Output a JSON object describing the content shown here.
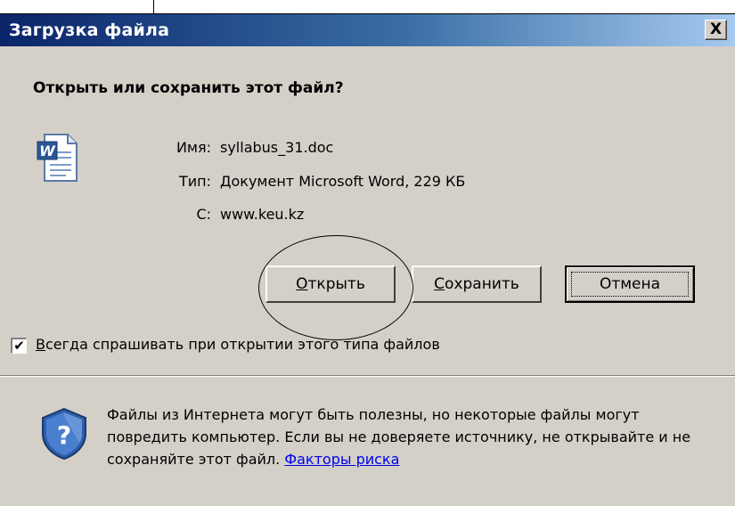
{
  "dialog": {
    "title": "Загрузка файла",
    "close_glyph": "X",
    "question": "Открыть или сохранить этот файл?",
    "file_icon": "word-document-icon",
    "file": {
      "name_label": "Имя:",
      "name_value": "syllabus_31.doc",
      "type_label": "Тип:",
      "type_value": "Документ Microsoft Word, 229 КБ",
      "from_label": "С:",
      "from_value": "www.keu.kz"
    },
    "buttons": {
      "open_accel": "О",
      "open_rest": "ткрыть",
      "save_accel": "С",
      "save_rest": "охранить",
      "cancel": "Отмена"
    },
    "checkbox": {
      "checked": true,
      "mark": "✔",
      "label_accel": "В",
      "label_rest": "сегда спрашивать при открытии этого типа файлов"
    },
    "warning": {
      "icon": "shield-question-icon",
      "text": "Файлы из Интернета могут быть полезны, но некоторые файлы могут повредить компьютер. Если вы не доверяете источнику, не открывайте и не сохраняйте этот файл.",
      "link": "Факторы риска"
    }
  }
}
